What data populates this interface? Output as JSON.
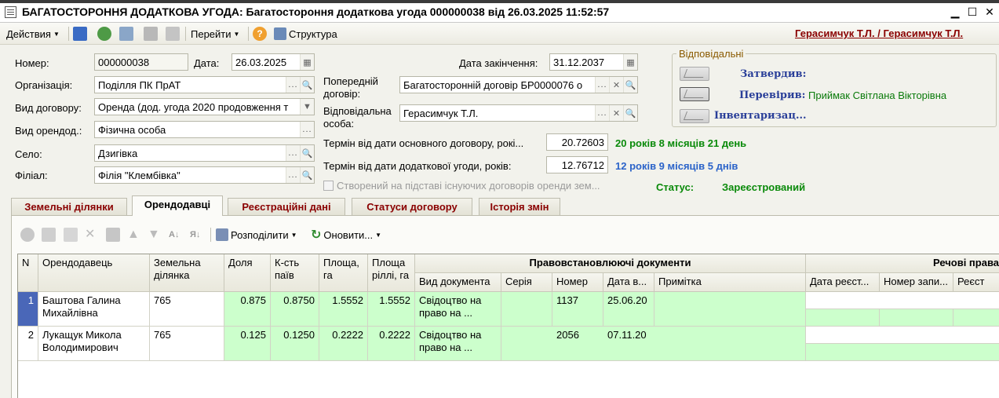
{
  "window": {
    "title": "БАГАТОСТОРОННЯ ДОДАТКОВА УГОДА: Багатостороння додаткова угода 000000038 від 26.03.2025 11:52:57",
    "minimize": "▁",
    "maximize": "☐",
    "close": "✕"
  },
  "toolbar": {
    "actions_label": "Действия",
    "goto_label": "Перейти",
    "structure_label": "Структура",
    "user": "Герасимчук Т.Л.  /  Герасимчук Т.Л."
  },
  "form": {
    "number_label": "Номер:",
    "number_value": "000000038",
    "date_label": "Дата:",
    "date_value": "26.03.2025",
    "end_date_label": "Дата закінчення:",
    "end_date_value": "31.12.2037",
    "org_label": "Організація:",
    "org_value": "Поділля ПК ПрАТ",
    "contract_type_label": "Вид договору:",
    "contract_type_value": "Оренда (дод. угода 2020 продовження т",
    "lessor_type_label": "Вид орендод.:",
    "lessor_type_value": "Фізична особа",
    "village_label": "Село:",
    "village_value": "Дзигівка",
    "branch_label": "Філіал:",
    "branch_value": "Філія \"Клембівка\"",
    "prev_contract_label_1": "Попередній",
    "prev_contract_label_2": "договір:",
    "prev_contract_value": "Багатосторонній договір БР0000076 о",
    "responsible_label_1": "Відповідальна",
    "responsible_label_2": "особа:",
    "responsible_value": "Герасимчук Т.Л.",
    "term_main_label": "Термін від дати основного договору, рокі...",
    "term_main_value": "20.72603",
    "term_main_text": "20 років 8 місяців 21 день",
    "term_add_label": "Термін від дати додаткової угоди, років:",
    "term_add_value": "12.76712",
    "term_add_text": "12 років 9 місяців 5 днів",
    "created_checkbox_label": "Створений на підставі існуючих договорів оренди зем...",
    "status_label": "Статус:",
    "status_value": "Зареєстрований"
  },
  "responsible_group": {
    "title": "Відповідальні",
    "approved_label": "Затвердив:",
    "checked_label": "Перевірив:",
    "checked_value": "Приймак Світлана Вікторівна",
    "inventory_label": "Інвентаризац..."
  },
  "tabs": [
    "Земельні ділянки",
    "Орендодавці",
    "Реєстраційні дані",
    "Статуси договору",
    "Історія змін"
  ],
  "grid_toolbar": {
    "distribute_label": "Розподілити",
    "refresh_label": "Оновити..."
  },
  "grid": {
    "headers": {
      "n": "N",
      "lessor": "Орендодавець",
      "plot": "Земельна ділянка",
      "share": "Доля",
      "shares_count": "К-сть паїв",
      "area": "Площа, га",
      "arable_area": "Площа ріллі, га",
      "docs_group": "Правовстановлюючі документи",
      "doc_type": "Вид документа",
      "series": "Серія",
      "number": "Номер",
      "date_issued": "Дата в...",
      "note": "Примітка",
      "rights_group": "Речові права",
      "reg_date": "Дата реєст...",
      "record_number": "Номер запи...",
      "registry": "Реєст"
    },
    "rows": [
      {
        "n": "1",
        "lessor": "Баштова Галина Михайлівна",
        "plot": "765",
        "share": "0.875",
        "shares_count": "0.8750",
        "area": "1.5552",
        "arable_area": "1.5552",
        "doc_type": "Свідоцтво на право на ...",
        "series": "",
        "number": "1137",
        "date_issued": "25.06.20",
        "note": ""
      },
      {
        "n": "2",
        "lessor": "Лукащук Микола Володимирович",
        "plot": "765",
        "share": "0.125",
        "shares_count": "0.1250",
        "area": "0.2222",
        "arable_area": "0.2222",
        "doc_type": "Свідоцтво на право на ...",
        "series": "",
        "number": "2056",
        "date_issued": "07.11.20",
        "note": ""
      }
    ]
  },
  "colors": {
    "accent_red": "#8a0000",
    "green_text": "#0a8a0a",
    "blue_text": "#2b63c9",
    "cell_green": "#ccffcc"
  }
}
